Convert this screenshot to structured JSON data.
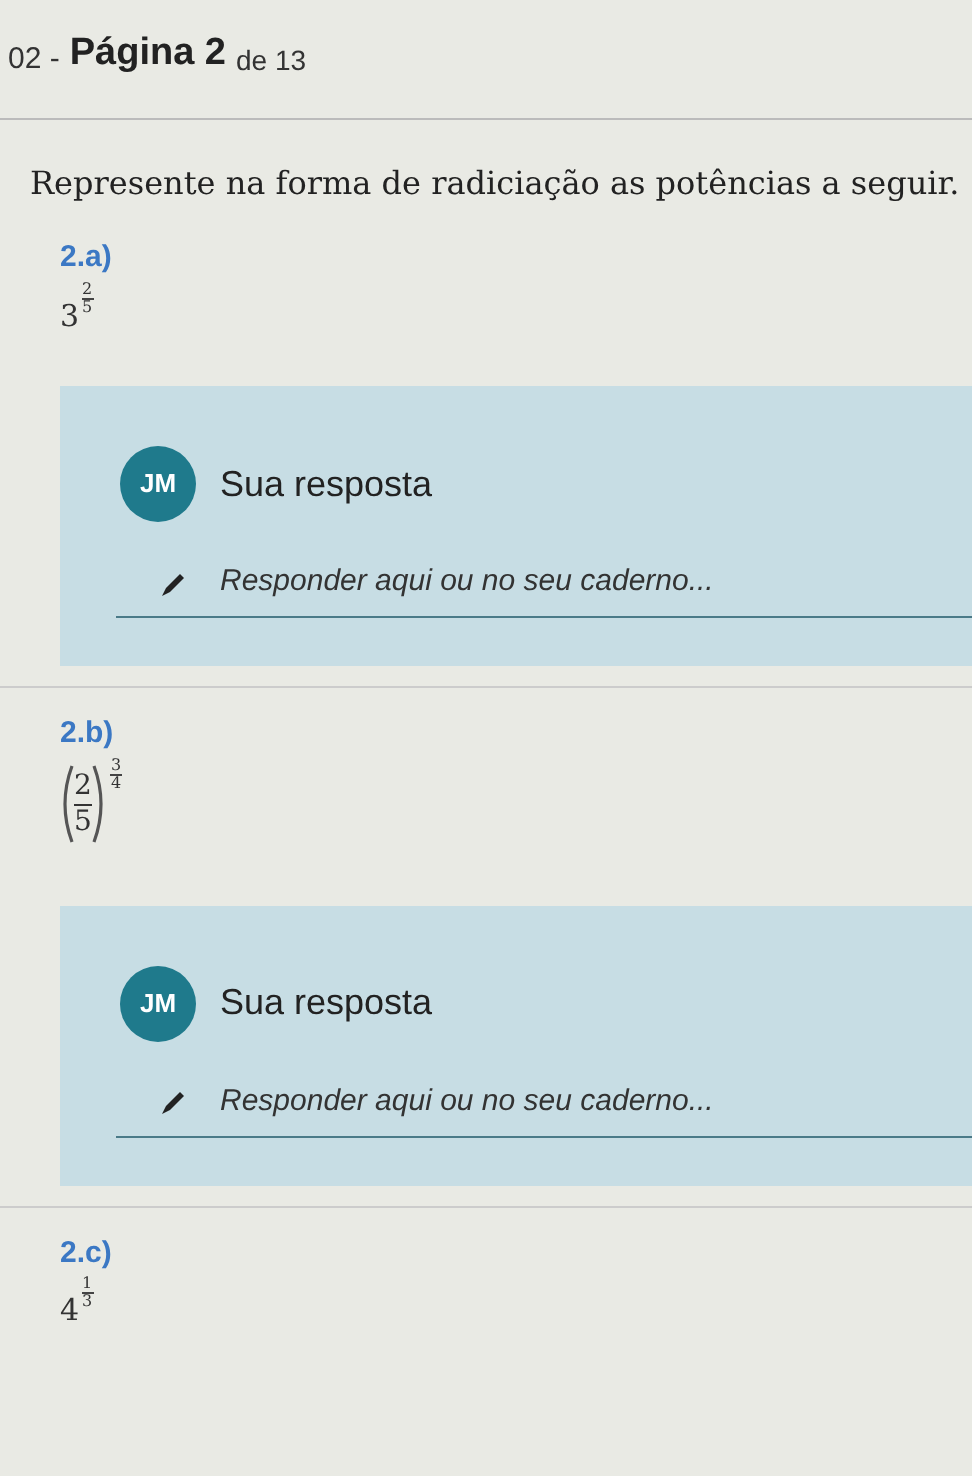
{
  "header": {
    "prefix": "02 -",
    "title": "Página 2",
    "suffix": "de 13"
  },
  "instruction": "Represente na forma de radiciação as potências a seguir.",
  "questions": [
    {
      "label": "2.a)",
      "kind": "power",
      "base": "3",
      "numerator": "2",
      "denominator": "5",
      "answer": {
        "avatar": "JM",
        "title": "Sua resposta",
        "placeholder": "Responder aqui ou no seu caderno..."
      }
    },
    {
      "label": "2.b)",
      "kind": "fraction_power",
      "base_numerator": "2",
      "base_denominator": "5",
      "numerator": "3",
      "denominator": "4",
      "answer": {
        "avatar": "JM",
        "title": "Sua resposta",
        "placeholder": "Responder aqui ou no seu caderno..."
      }
    },
    {
      "label": "2.c)",
      "kind": "power",
      "base": "4",
      "numerator": "1",
      "denominator": "3"
    }
  ]
}
